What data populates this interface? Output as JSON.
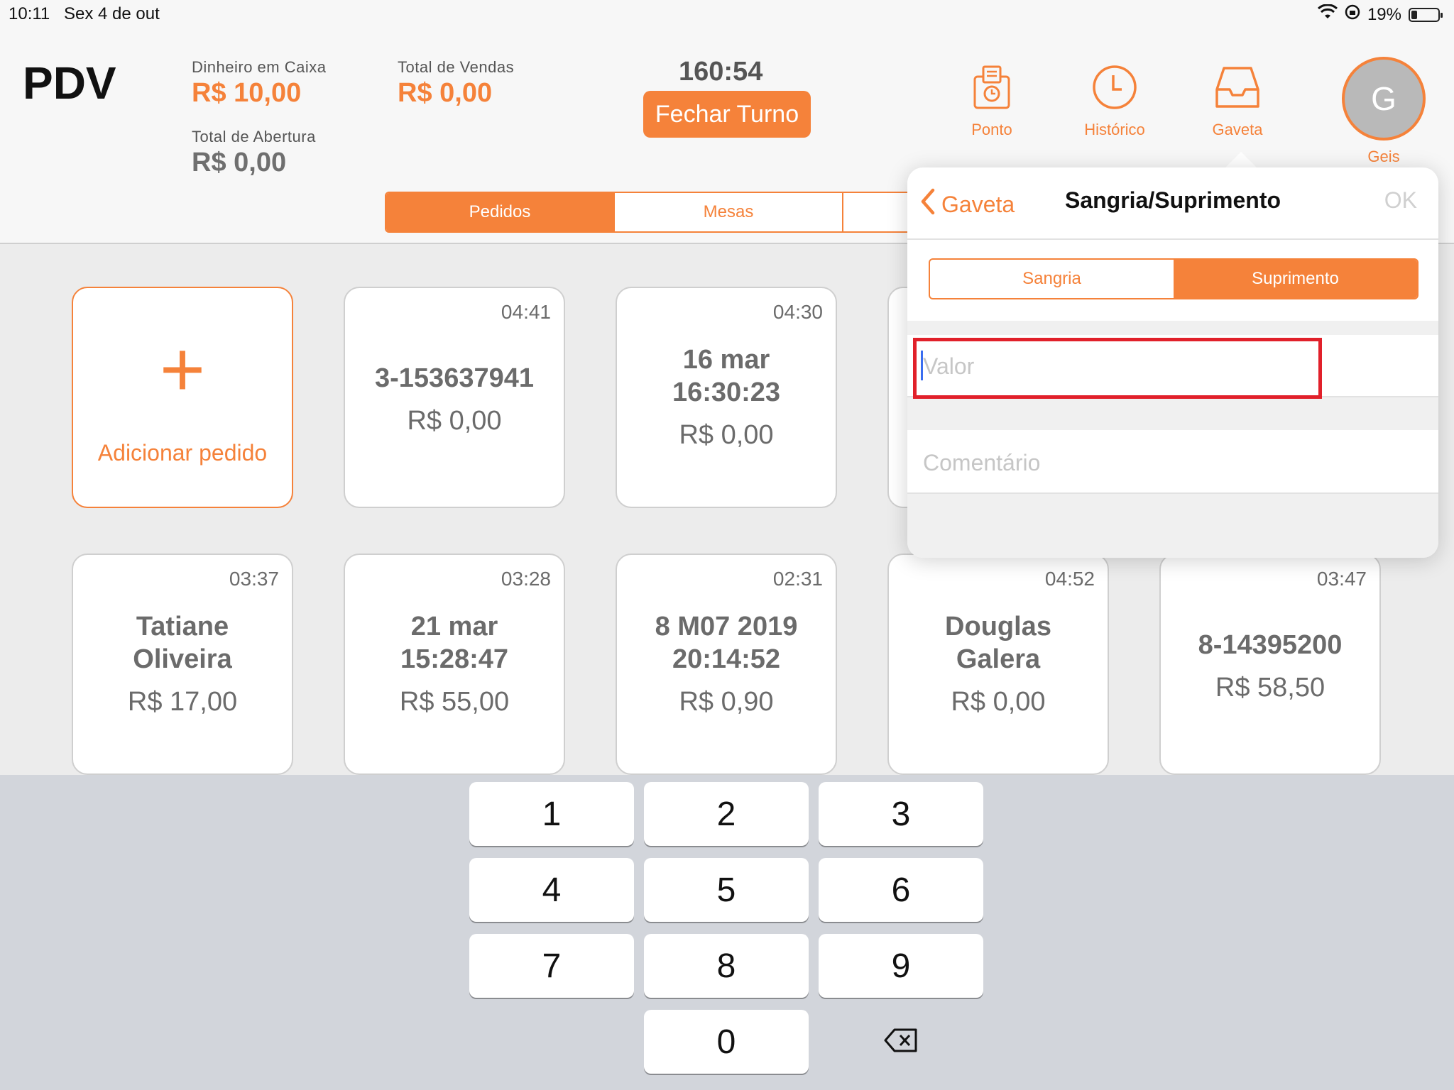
{
  "status_bar": {
    "time": "10:11",
    "date": "Sex 4 de out",
    "battery": "19%",
    "battery_level": 0.19
  },
  "header": {
    "title": "PDV",
    "cash_label": "Dinheiro em Caixa",
    "cash_value": "R$ 10,00",
    "sales_label": "Total de Vendas",
    "sales_value": "R$ 0,00",
    "opening_label": "Total de Abertura",
    "opening_value": "R$ 0,00",
    "timer": "160:54",
    "close_shift": "Fechar Turno",
    "nav": {
      "ponto": "Ponto",
      "historico": "Histórico",
      "gaveta": "Gaveta"
    },
    "user_initial": "G",
    "user_name": "Geis"
  },
  "tabs": [
    "Pedidos",
    "Mesas"
  ],
  "add_order": "Adicionar pedido",
  "orders": [
    {
      "time": "04:41",
      "title": "3-153637941",
      "price": "R$ 0,00"
    },
    {
      "time": "04:30",
      "title": "16 mar 16:30:23",
      "price": "R$ 0,00"
    },
    {
      "time": "03:37",
      "title": "Tatiane Oliveira",
      "price": "R$ 17,00"
    },
    {
      "time": "03:28",
      "title": "21 mar 15:28:47",
      "price": "R$ 55,00"
    },
    {
      "time": "02:31",
      "title": "8 M07 2019 20:14:52",
      "price": "R$ 0,90"
    },
    {
      "time": "04:52",
      "title": "Douglas Galera",
      "price": "R$ 0,00"
    },
    {
      "time": "03:47",
      "title": "8-14395200",
      "price": "R$ 58,50"
    }
  ],
  "popover": {
    "back": "Gaveta",
    "title": "Sangria/Suprimento",
    "ok": "OK",
    "seg_left": "Sangria",
    "seg_right": "Suprimento",
    "value_placeholder": "Valor",
    "comment_placeholder": "Comentário"
  },
  "keypad": [
    "1",
    "2",
    "3",
    "4",
    "5",
    "6",
    "7",
    "8",
    "9",
    "0"
  ],
  "colors": {
    "accent": "#f5823a",
    "highlight": "#e1202a"
  }
}
